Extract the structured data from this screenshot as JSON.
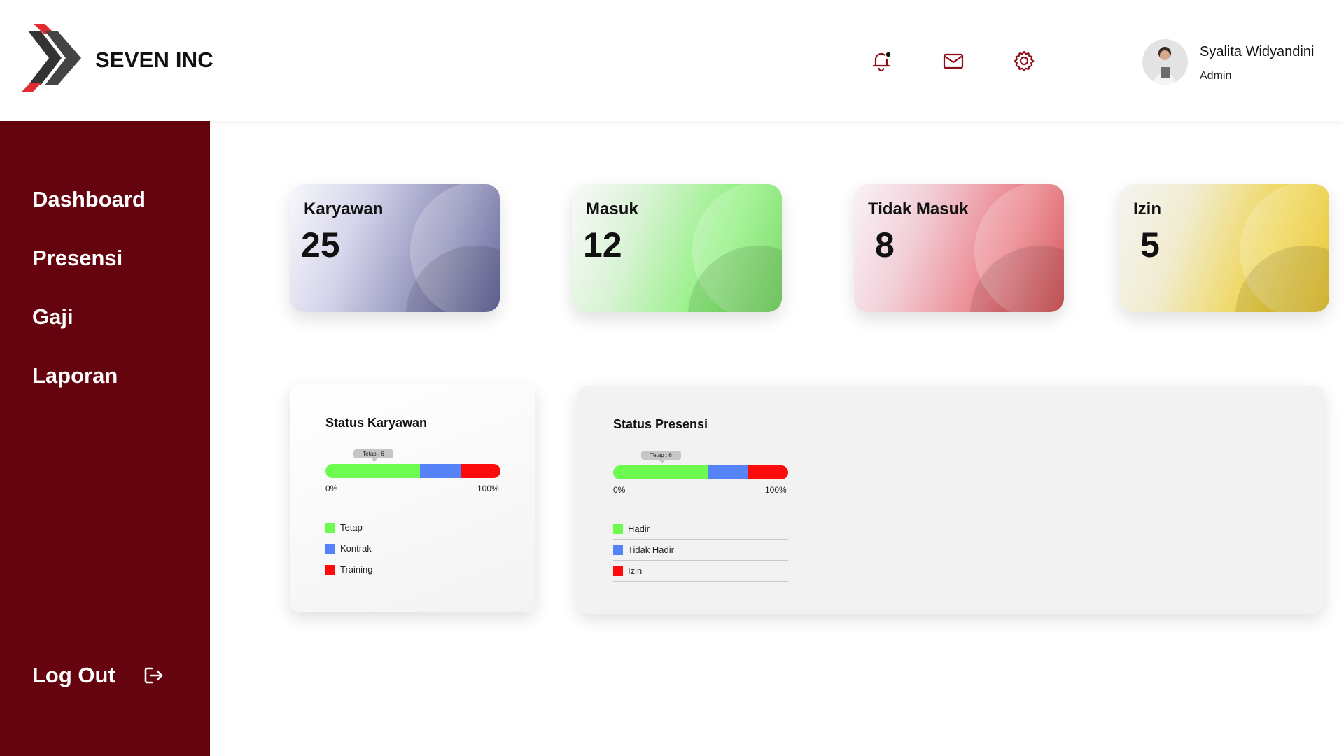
{
  "header": {
    "brand": "SEVEN INC",
    "icons": [
      "bell-icon",
      "mail-icon",
      "gear-icon"
    ],
    "user": {
      "name": "Syalita Widyandini",
      "role": "Admin"
    }
  },
  "sidebar": {
    "items": [
      {
        "label": "Dashboard"
      },
      {
        "label": "Presensi"
      },
      {
        "label": "Gaji"
      },
      {
        "label": "Laporan"
      }
    ],
    "logout_label": "Log Out",
    "background": "#65030e"
  },
  "stats": [
    {
      "title": "Karyawan",
      "value": "25"
    },
    {
      "title": "Masuk",
      "value": "12"
    },
    {
      "title": "Tidak Masuk",
      "value": "8"
    },
    {
      "title": "Izin",
      "value": "5"
    }
  ],
  "status_karyawan": {
    "title": "Status Karyawan",
    "tooltip": "Tetap : 6",
    "scale_min": "0%",
    "scale_max": "100%",
    "legend": [
      {
        "label": "Tetap",
        "color": "#6dfb4f"
      },
      {
        "label": "Kontrak",
        "color": "#5583f7"
      },
      {
        "label": "Training",
        "color": "#fb0b0b"
      }
    ]
  },
  "status_presensi": {
    "title": "Status Presensi",
    "tooltip": "Tetap : 6",
    "scale_min": "0%",
    "scale_max": "100%",
    "legend": [
      {
        "label": "Hadir",
        "color": "#6dfb4f"
      },
      {
        "label": "Tidak Hadir",
        "color": "#5583f7"
      },
      {
        "label": "Izin",
        "color": "#fb0b0b"
      }
    ]
  },
  "chart_data": [
    {
      "type": "bar",
      "title": "Status Karyawan",
      "categories": [
        "Tetap",
        "Kontrak",
        "Training"
      ],
      "values": [
        54,
        23,
        23
      ],
      "unit": "%",
      "ylim": [
        0,
        100
      ]
    },
    {
      "type": "bar",
      "title": "Status Presensi",
      "categories": [
        "Hadir",
        "Tidak Hadir",
        "Izin"
      ],
      "values": [
        54,
        23,
        23
      ],
      "unit": "%",
      "ylim": [
        0,
        100
      ]
    }
  ]
}
